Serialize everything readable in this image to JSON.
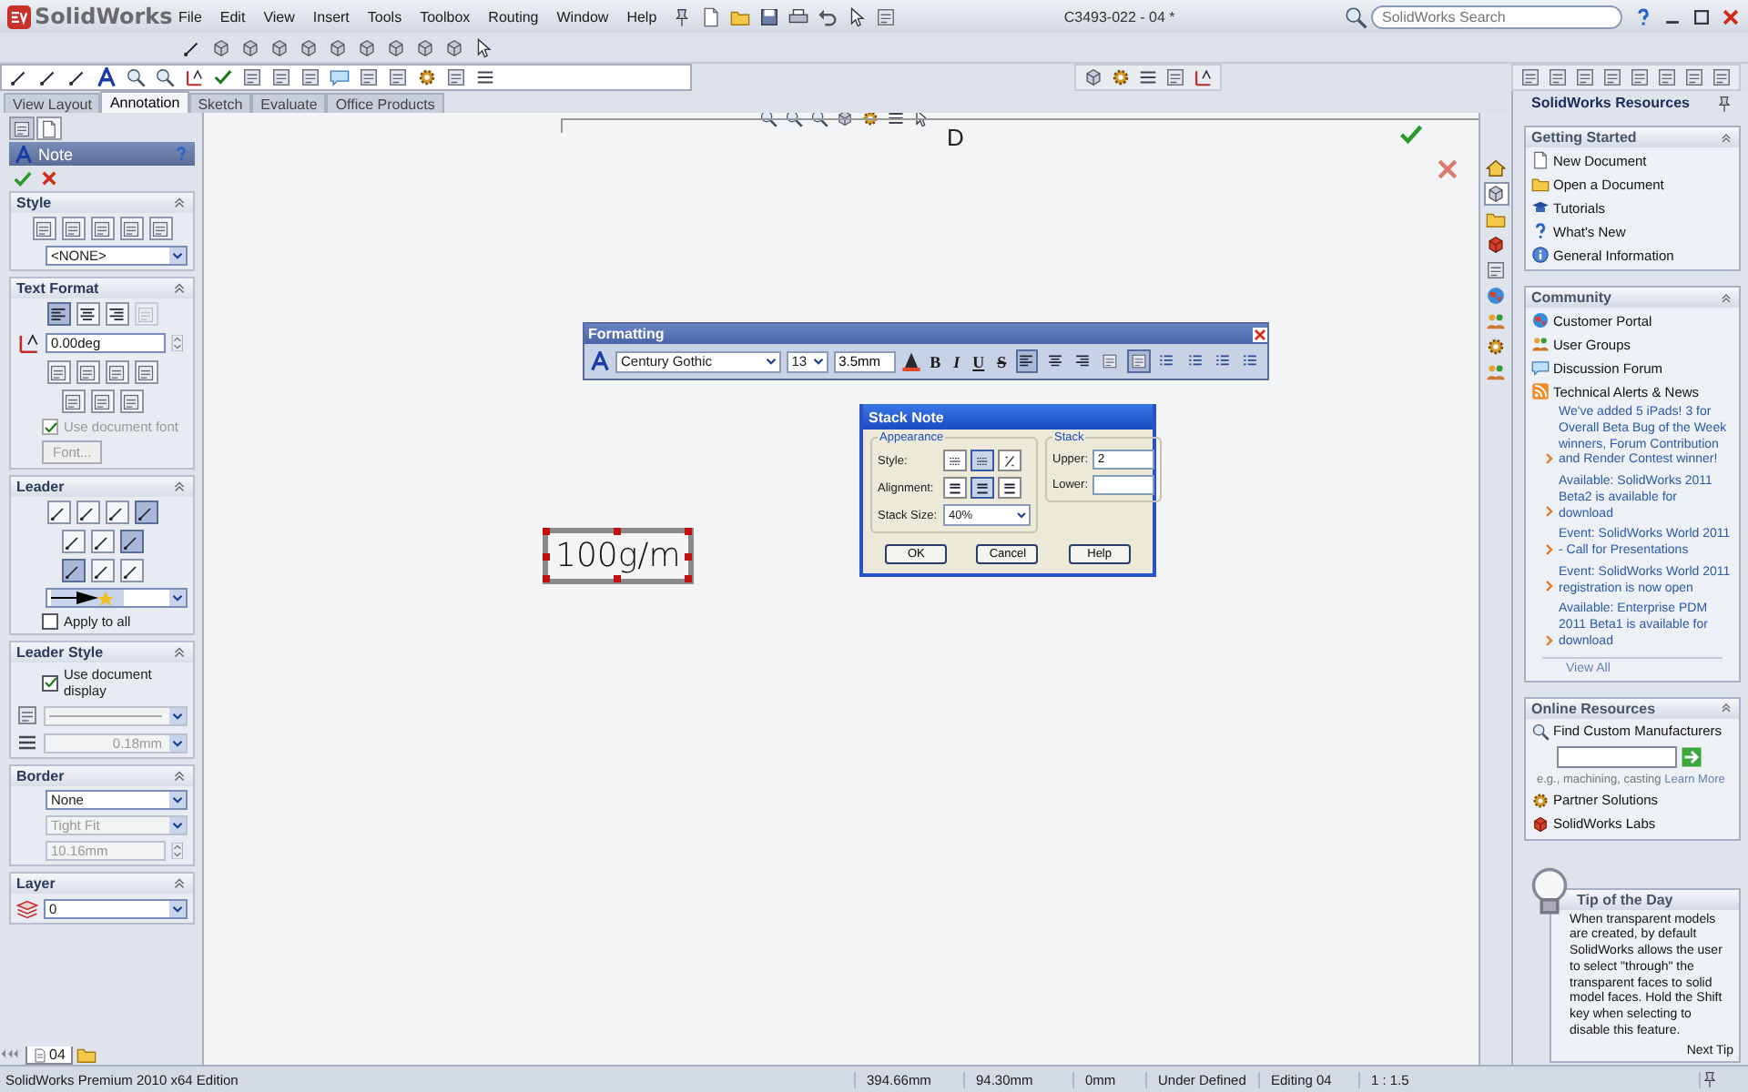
{
  "header": {
    "logo": "SolidWorks",
    "menu": [
      "File",
      "Edit",
      "View",
      "Insert",
      "Tools",
      "Toolbox",
      "Routing",
      "Window",
      "Help"
    ],
    "document_title": "C3493-022 - 04 *",
    "search": {
      "placeholder": "SolidWorks Search"
    }
  },
  "command_tabs": [
    {
      "label": "View Layout",
      "selected": false
    },
    {
      "label": "Annotation",
      "selected": true
    },
    {
      "label": "Sketch",
      "selected": false
    },
    {
      "label": "Evaluate",
      "selected": false
    },
    {
      "label": "Office Products",
      "selected": false
    }
  ],
  "property_manager": {
    "tabs": [
      {
        "selected": false
      },
      {
        "selected": true
      }
    ],
    "title": "Note",
    "sections": [
      {
        "title": "Style",
        "items": [
          {
            "kind": "icon_row",
            "buttons": [
              {
                "selected": false
              },
              {
                "selected": false
              },
              {
                "selected": false
              },
              {
                "selected": false
              },
              {
                "selected": false
              }
            ]
          },
          {
            "kind": "select",
            "value": "<NONE>",
            "disabled": false
          }
        ]
      },
      {
        "title": "Text Format",
        "items": [
          {
            "kind": "align_row",
            "buttons": [
              {
                "selected": true,
                "disabled": false
              },
              {
                "selected": false,
                "disabled": false
              },
              {
                "selected": false,
                "disabled": false
              },
              {
                "selected": false,
                "disabled": true
              }
            ]
          },
          {
            "kind": "angle_field",
            "value": "0.00deg",
            "disabled": false
          },
          {
            "kind": "icon_row",
            "buttons": [
              {
                "selected": false
              },
              {
                "selected": false
              },
              {
                "selected": false
              },
              {
                "selected": false
              }
            ]
          },
          {
            "kind": "icon_row",
            "buttons": [
              {
                "selected": false
              },
              {
                "selected": false
              },
              {
                "selected": false
              }
            ]
          },
          {
            "kind": "checkbox",
            "label": "Use document font",
            "checked": true,
            "disabled": true
          },
          {
            "kind": "button",
            "label": "Font...",
            "disabled": true
          }
        ]
      },
      {
        "title": "Leader",
        "items": [
          {
            "kind": "icon_row",
            "buttons": [
              {
                "selected": false
              },
              {
                "selected": false
              },
              {
                "selected": false
              },
              {
                "selected": true
              }
            ]
          },
          {
            "kind": "icon_row",
            "buttons": [
              {
                "selected": false
              },
              {
                "selected": false
              },
              {
                "selected": true
              }
            ]
          },
          {
            "kind": "icon_row",
            "buttons": [
              {
                "selected": true
              },
              {
                "selected": false
              },
              {
                "selected": false
              }
            ]
          },
          {
            "kind": "arrow_select",
            "disabled": false
          },
          {
            "kind": "checkbox",
            "label": "Apply to all",
            "checked": false,
            "disabled": false
          }
        ]
      },
      {
        "title": "Leader Style",
        "items": [
          {
            "kind": "checkbox",
            "label": "Use document display",
            "checked": true,
            "disabled": false
          },
          {
            "kind": "line_style_select",
            "disabled": true
          },
          {
            "kind": "line_weight_select",
            "value": "0.18mm",
            "disabled": true
          }
        ]
      },
      {
        "title": "Border",
        "items": [
          {
            "kind": "select",
            "value": "None",
            "disabled": false
          },
          {
            "kind": "select",
            "value": "Tight Fit",
            "disabled": true
          },
          {
            "kind": "field",
            "value": "10.16mm",
            "disabled": true
          }
        ]
      },
      {
        "title": "Layer",
        "items": [
          {
            "kind": "layer_select",
            "value": "0",
            "disabled": false
          }
        ]
      }
    ]
  },
  "sheet_tabs": [
    {
      "label": "04",
      "selected": true
    }
  ],
  "canvas": {
    "zone_label": "D",
    "note": {
      "text": "100g/m",
      "selected": true
    },
    "formatting": {
      "title": "Formatting",
      "font": "Century Gothic",
      "size": "13",
      "height": "3.5mm",
      "styles": [
        "B",
        "I",
        "U",
        "S"
      ],
      "align": [
        {
          "selected": true
        },
        {
          "selected": false
        },
        {
          "selected": false
        }
      ],
      "list_buttons": [
        {
          "selected": false
        },
        {
          "selected": true
        },
        {
          "selected": false
        },
        {
          "selected": false
        },
        {
          "selected": false
        },
        {
          "selected": false
        }
      ]
    },
    "stack_note": {
      "title": "Stack Note",
      "appearance": {
        "title": "Appearance",
        "style_label": "Style:",
        "styles": [
          {
            "selected": false
          },
          {
            "selected": true
          },
          {
            "selected": false
          }
        ],
        "alignment_label": "Alignment:",
        "alignments": [
          {
            "selected": false
          },
          {
            "selected": true
          },
          {
            "selected": false
          }
        ],
        "size_label": "Stack Size:",
        "size": "40%"
      },
      "stack": {
        "title": "Stack",
        "upper_label": "Upper:",
        "upper": "2",
        "lower_label": "Lower:"
      },
      "buttons": [
        "OK",
        "Cancel",
        "Help"
      ]
    }
  },
  "task_pane_tabs": [
    {
      "selected": false
    },
    {
      "selected": true
    },
    {
      "selected": false
    },
    {
      "selected": false
    },
    {
      "selected": false
    },
    {
      "selected": false
    },
    {
      "selected": false
    },
    {
      "selected": false
    },
    {
      "selected": false
    }
  ],
  "resources": {
    "title": "SolidWorks Resources",
    "sections": [
      {
        "kind": "links",
        "title": "Getting Started",
        "links": [
          "New Document",
          "Open a Document",
          "Tutorials",
          "What's New",
          "General Information"
        ]
      },
      {
        "kind": "community",
        "title": "Community",
        "links": [
          "Customer Portal",
          "User Groups",
          "Discussion Forum",
          "Technical Alerts & News"
        ],
        "news": [
          "We've added 5 iPads! 3 for Overall Beta Bug of the Week winners, Forum Contribution and Render Contest winner!",
          "Available: SolidWorks 2011 Beta2 is available for download",
          "Event: SolidWorks World 2011 - Call for Presentations",
          "Event: SolidWorks World 2011 registration is now open",
          "Available: Enterprise PDM 2011 Beta1 is available for download"
        ],
        "view_all": "View All"
      },
      {
        "kind": "online",
        "title": "Online Resources",
        "find_label": "Find Custom Manufacturers",
        "hint": "e.g., machining, casting",
        "learn_more": "Learn More",
        "links": [
          "Partner Solutions",
          "SolidWorks Labs"
        ]
      }
    ],
    "tip": {
      "title": "Tip of the Day",
      "text": "When transparent models are created, by default SolidWorks allows the user to select \"through\" the transparent faces to solid model faces. Hold the Shift key when selecting to disable this feature.",
      "next": "Next Tip"
    }
  },
  "status_bar": [
    "SolidWorks Premium 2010 x64 Edition",
    "394.66mm",
    "94.30mm",
    "0mm",
    "Under Defined",
    "Editing 04",
    "1 : 1.5"
  ]
}
